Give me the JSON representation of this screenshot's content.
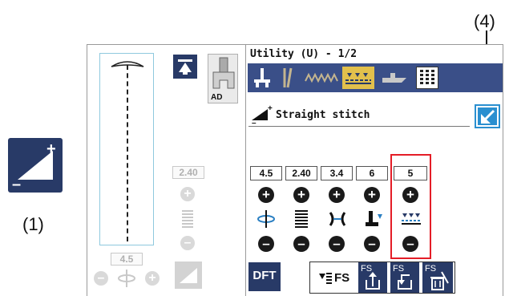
{
  "callouts": {
    "label_1": "(1)",
    "label_4": "(4)"
  },
  "screen": {
    "title": "Utility (U) - 1/2",
    "stitch_name": "Straight stitch",
    "ad_label": "AD",
    "left_values": {
      "width": "2.40",
      "position": "4.5"
    },
    "tool_icons": [
      "needle-stop-icon",
      "twin-needle-icon",
      "elongation-icon",
      "tie-off-icon",
      "presser-foot-icon",
      "memory-grid-icon"
    ],
    "settings": [
      {
        "value": "4.5",
        "icon": "needle-position-icon"
      },
      {
        "value": "2.40",
        "icon": "stitch-length-icon"
      },
      {
        "value": "3.4",
        "icon": "thread-tension-icon"
      },
      {
        "value": "6",
        "icon": "foot-pressure-icon"
      },
      {
        "value": "5",
        "icon": "feed-dog-icon"
      }
    ],
    "dft_label": "DFT",
    "fs_label": "FS",
    "fs_small": "FS",
    "colors": {
      "navy": "#283a67",
      "toolbar": "#3a4f88",
      "highlight": "#e2c04c",
      "red": "#e41d27",
      "blue_btn": "#2a8fd0"
    }
  }
}
